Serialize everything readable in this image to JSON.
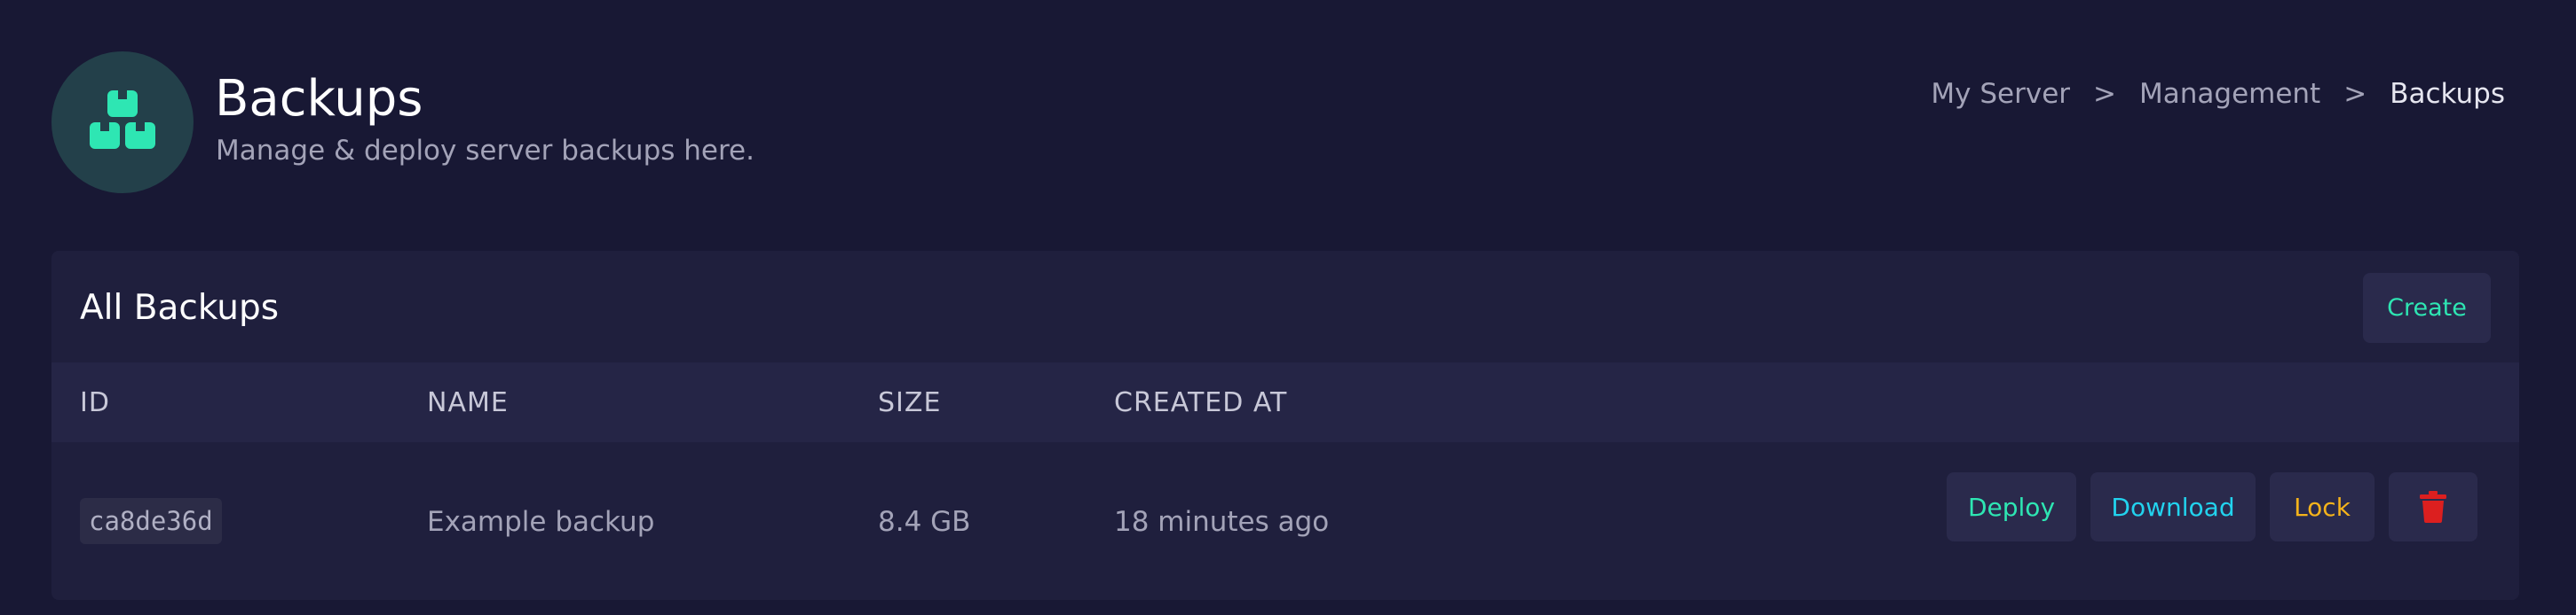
{
  "header": {
    "icon": "boxes-icon",
    "title": "Backups",
    "subtitle": "Manage & deploy server backups here.",
    "accent": "#2ee6b3"
  },
  "breadcrumb": {
    "items": [
      "My Server",
      "Management",
      "Backups"
    ],
    "separator": ">"
  },
  "backups_card": {
    "title": "All Backups",
    "create_label": "Create",
    "columns": [
      "ID",
      "NAME",
      "SIZE",
      "CREATED AT"
    ],
    "rows": [
      {
        "id": "ca8de36d",
        "name": "Example backup",
        "size": "8.4 GB",
        "created_at": "18 minutes ago",
        "actions": {
          "deploy": "Deploy",
          "download": "Download",
          "lock": "Lock",
          "delete_icon": "trash-icon"
        }
      }
    ]
  },
  "colors": {
    "background": "#181834",
    "card": "#1f1f3d",
    "deploy": "#2ee6b3",
    "download": "#22d3ee",
    "lock": "#f5b31b",
    "delete": "#dc1f1f"
  }
}
